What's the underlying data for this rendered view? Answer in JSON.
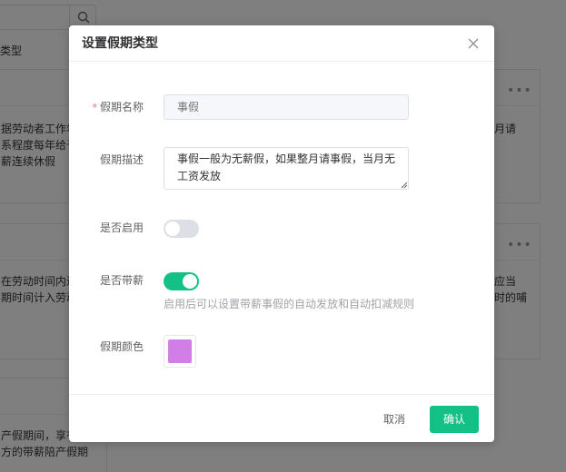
{
  "background": {
    "top_left_label": "类型",
    "cards": [
      {
        "text": "据劳动者工作年\n系程度每年给予\n薪连续休假"
      },
      {
        "text": "月请"
      },
      {
        "text": "在劳动时间内进\n期时间计入劳动"
      },
      {
        "text": "应当\n时的哺"
      },
      {
        "text": "产假期间，享有\n方的带薪陪产假期"
      }
    ],
    "more_icon_text": "•••"
  },
  "dialog": {
    "title": "设置假期类型",
    "fields": {
      "name": {
        "label": "假期名称",
        "required_mark": "*",
        "placeholder": "事假"
      },
      "description": {
        "label": "假期描述",
        "value": "事假一般为无薪假，如果整月请事假，当月无工资发放"
      },
      "enabled": {
        "label": "是否启用",
        "on": false
      },
      "paid": {
        "label": "是否带薪",
        "on": true,
        "hint": "启用后可以设置带薪事假的自动发放和自动扣减规则"
      },
      "color": {
        "label": "假期颜色",
        "value": "#d17fe6"
      }
    },
    "footer": {
      "cancel_label": "取消",
      "confirm_label": "确认"
    }
  },
  "colors": {
    "accent": "#13c085",
    "switch_off": "#dcdfe6",
    "required": "#f56c6c"
  }
}
